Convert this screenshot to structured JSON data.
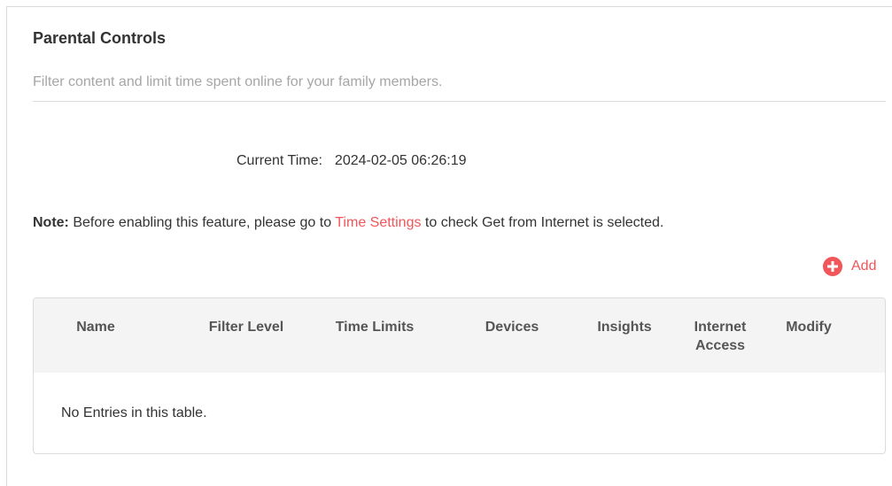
{
  "page": {
    "title": "Parental Controls",
    "subtitle": "Filter content and limit time spent online for your family members."
  },
  "time": {
    "label": "Current Time:",
    "value": "2024-02-05 06:26:19"
  },
  "note": {
    "prefix": "Note:",
    "text_before": " Before enabling this feature, please go to ",
    "link": "Time Settings",
    "text_after": " to check Get from Internet is selected."
  },
  "add": {
    "label": "Add",
    "icon": "plus-circle-icon"
  },
  "table": {
    "columns": [
      "Name",
      "Filter Level",
      "Time Limits",
      "Devices",
      "Insights",
      "Internet Access",
      "Modify"
    ],
    "empty_text": "No Entries in this table."
  },
  "colors": {
    "accent": "#f0565a",
    "header_bg": "#f4f4f4",
    "muted_text": "#a6a6a6"
  }
}
